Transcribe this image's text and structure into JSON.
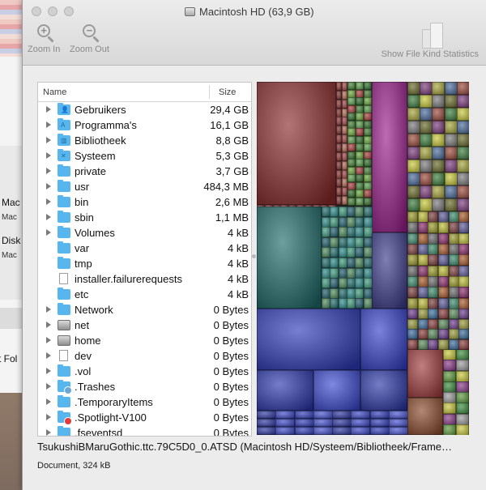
{
  "background_window": {
    "items": [
      {
        "name": "Mac",
        "sub": "Mac"
      },
      {
        "name": "Disk",
        "sub": "Mac"
      }
    ],
    "bottom_label": "t Fol"
  },
  "window": {
    "title": "Macintosh HD (63,9 GB)",
    "toolbar": {
      "zoom_in": "Zoom In",
      "zoom_out": "Zoom Out",
      "file_kind_stats": "Show File Kind Statistics"
    },
    "list": {
      "col_name": "Name",
      "col_size": "Size",
      "rows": [
        {
          "name": "Gebruikers",
          "size": "29,4 GB",
          "expandable": true,
          "icon": "users-folder-icon",
          "glyph": "👤"
        },
        {
          "name": "Programma's",
          "size": "16,1 GB",
          "expandable": true,
          "icon": "applications-folder-icon",
          "glyph": "A"
        },
        {
          "name": "Bibliotheek",
          "size": "8,8 GB",
          "expandable": true,
          "icon": "library-folder-icon",
          "glyph": "▥"
        },
        {
          "name": "Systeem",
          "size": "5,3 GB",
          "expandable": true,
          "icon": "system-folder-icon",
          "glyph": "✕"
        },
        {
          "name": "private",
          "size": "3,7 GB",
          "expandable": true,
          "icon": "folder-icon",
          "glyph": ""
        },
        {
          "name": "usr",
          "size": "484,3 MB",
          "expandable": true,
          "icon": "folder-icon",
          "glyph": ""
        },
        {
          "name": "bin",
          "size": "2,6 MB",
          "expandable": true,
          "icon": "folder-icon",
          "glyph": ""
        },
        {
          "name": "sbin",
          "size": "1,1 MB",
          "expandable": true,
          "icon": "folder-icon",
          "glyph": ""
        },
        {
          "name": "Volumes",
          "size": "4 kB",
          "expandable": true,
          "icon": "folder-icon",
          "glyph": ""
        },
        {
          "name": "var",
          "size": "4 kB",
          "expandable": false,
          "icon": "folder-icon",
          "glyph": ""
        },
        {
          "name": "tmp",
          "size": "4 kB",
          "expandable": false,
          "icon": "folder-icon",
          "glyph": ""
        },
        {
          "name": "installer.failurerequests",
          "size": "4 kB",
          "expandable": false,
          "icon": "document-icon",
          "glyph": ""
        },
        {
          "name": "etc",
          "size": "4 kB",
          "expandable": false,
          "icon": "folder-icon",
          "glyph": ""
        },
        {
          "name": "Network",
          "size": "0 Bytes",
          "expandable": true,
          "icon": "folder-icon",
          "glyph": ""
        },
        {
          "name": "net",
          "size": "0 Bytes",
          "expandable": true,
          "icon": "disk-icon",
          "glyph": ""
        },
        {
          "name": "home",
          "size": "0 Bytes",
          "expandable": true,
          "icon": "disk-icon",
          "glyph": ""
        },
        {
          "name": "dev",
          "size": "0 Bytes",
          "expandable": true,
          "icon": "document-icon",
          "glyph": ""
        },
        {
          "name": ".vol",
          "size": "0 Bytes",
          "expandable": true,
          "icon": "folder-icon",
          "glyph": ""
        },
        {
          "name": ".Trashes",
          "size": "0 Bytes",
          "expandable": true,
          "icon": "folder-badge-icon",
          "glyph": ""
        },
        {
          "name": ".TemporaryItems",
          "size": "0 Bytes",
          "expandable": true,
          "icon": "folder-icon",
          "glyph": ""
        },
        {
          "name": ".Spotlight-V100",
          "size": "0 Bytes",
          "expandable": true,
          "icon": "folder-restricted-icon",
          "glyph": ""
        },
        {
          "name": ".fseventsd",
          "size": "0 Bytes",
          "expandable": true,
          "icon": "folder-icon",
          "glyph": ""
        }
      ]
    },
    "status": {
      "path": "TsukushiBMaruGothic.ttc.79C5D0_0.ATSD (Macintosh HD/Systeem/Bibliotheek/Frame…",
      "kind": "Document, 324 kB"
    },
    "colors": {
      "folder": "#58b6ef",
      "treemap_red": "#8a2a2a",
      "treemap_green": "#3c7a2c",
      "treemap_magenta": "#9a1e8c",
      "treemap_teal": "#1f6b6b",
      "treemap_blue": "#2d3ab8"
    }
  }
}
